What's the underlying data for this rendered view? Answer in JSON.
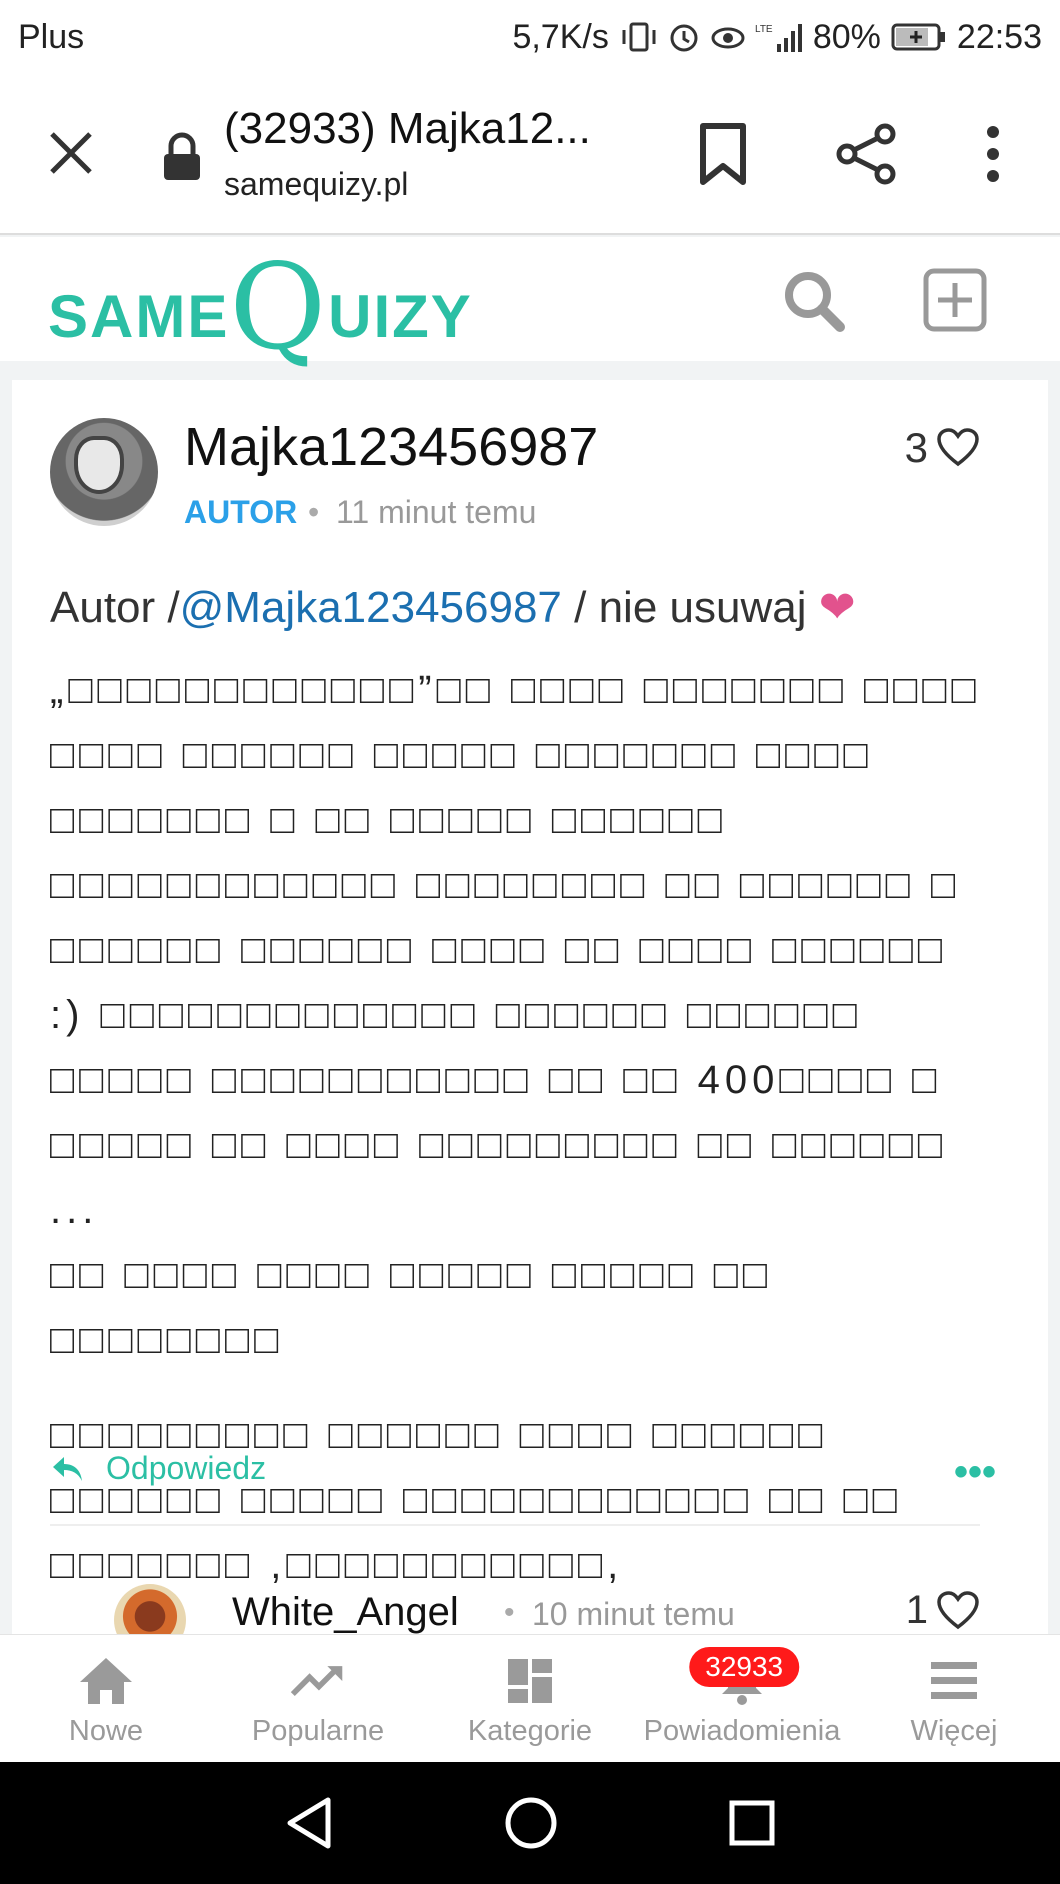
{
  "status_bar": {
    "carrier": "Plus",
    "speed": "5,7K/s",
    "battery": "80%",
    "time": "22:53"
  },
  "browser": {
    "tab_title": "(32933) Majka12...",
    "url": "samequizy.pl"
  },
  "site": {
    "logo_same": "SAME",
    "logo_q": "Q",
    "logo_uizy": "UIZY"
  },
  "post": {
    "username": "Majka123456987",
    "role": "AUTOR",
    "time": "11 minut temu",
    "likes": "3",
    "lead_prefix": "Autor /",
    "mention": "@Majka123456987",
    "lead_suffix": " / nie usuwaj ",
    "lead_heart": "❤",
    "paragraph1": "„□□□□□□□□□□□□”□□ □□□□ □□□□□□□ □□□□ □□□□ □□□□□□ □□□□□ □□□□□□□ □□□□ □□□□□□□ □ □□ □□□□□ □□□□□□ □□□□□□□□□□□□ □□□□□□□□ □□ □□□□□□ □ □□□□□□ □□□□□□ □□□□ □□ □□□□ □□□□□□ :) □□□□□□□□□□□□□ □□□□□□ □□□□□□ □□□□□ □□□□□□□□□□□ □□ □□ 400□□□□ □ □□□□□ □□ □□□□ □□□□□□□□□ □□ □□□□□□ ...",
    "paragraph1b": "□□ □□□□ □□□□ □□□□□ □□□□□ □□ □□□□□□□□",
    "paragraph2": "□□□□□□□□□ □□□□□□ □□□□ □□□□□□ □□□□□□ □□□□□ □□□□□□□□□□□□ □□ □□ □□□□□□□ ,□□□□□□□□□□□,",
    "reply_label": "Odpowiedz",
    "more_label": "•••"
  },
  "reply": {
    "username": "White_Angel",
    "time": "10 minut temu",
    "likes": "1"
  },
  "bottom_nav": {
    "items": [
      {
        "label": "Nowe"
      },
      {
        "label": "Popularne"
      },
      {
        "label": "Kategorie"
      },
      {
        "label": "Powiadomienia"
      },
      {
        "label": "Więcej"
      }
    ],
    "notification_count": "32933"
  },
  "colors": {
    "brand": "#2bbfa4",
    "role": "#2ba0e8",
    "badge": "#ff1a1a"
  }
}
